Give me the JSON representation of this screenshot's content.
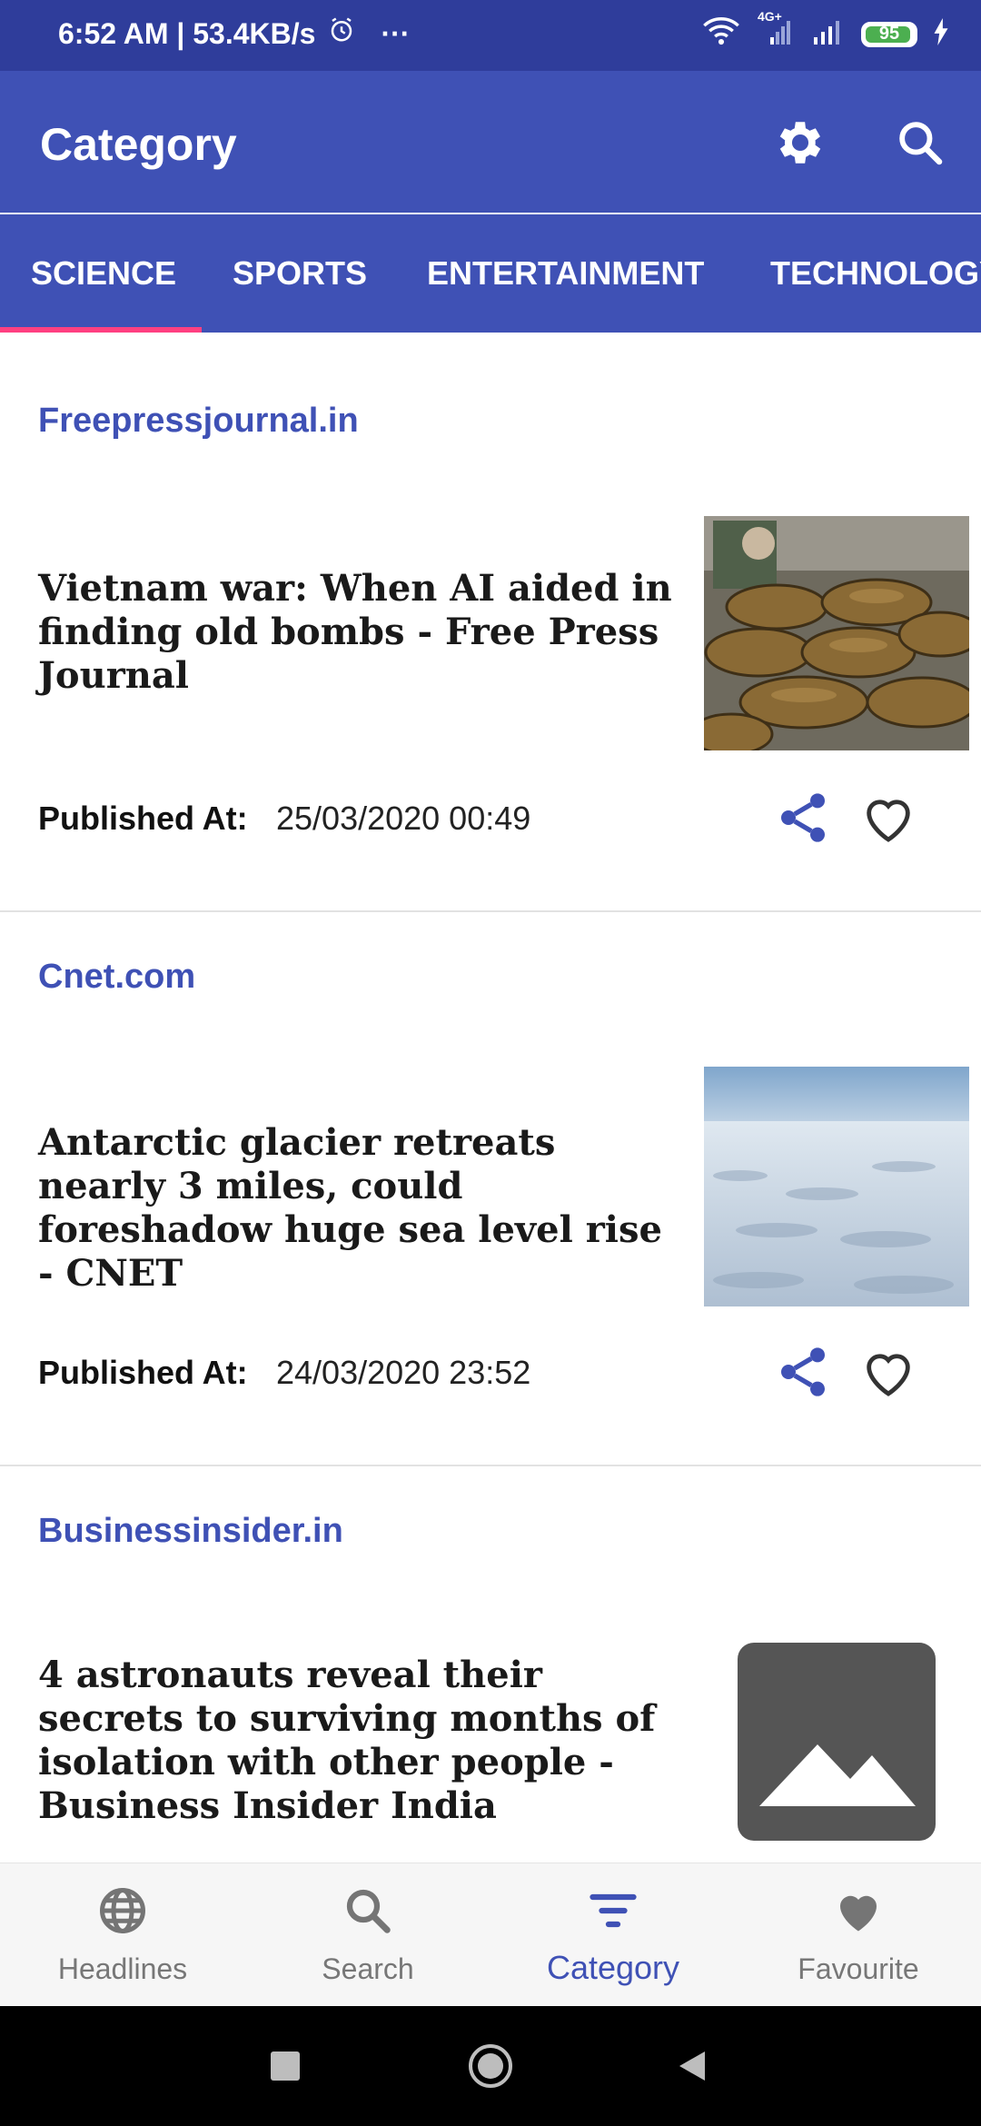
{
  "status_bar": {
    "time_speed": "6:52 AM | 53.4KB/s",
    "more": "···",
    "network_label": "4G+",
    "battery": "95",
    "battery_level": 0.95
  },
  "app_bar": {
    "title": "Category",
    "icons": [
      "gear-icon",
      "search-icon"
    ]
  },
  "tabs": [
    {
      "label": "SCIENCE",
      "selected": true
    },
    {
      "label": "SPORTS",
      "selected": false
    },
    {
      "label": "ENTERTAINMENT",
      "selected": false
    },
    {
      "label": "TECHNOLOGY",
      "selected": false
    }
  ],
  "articles": [
    {
      "source": "Freepressjournal.in",
      "title": "Vietnam war: When AI aided in finding old bombs - Free Press Journal",
      "published_label": "Published At:",
      "published_at": "25/03/2020 00:49"
    },
    {
      "source": "Cnet.com",
      "title": "Antarctic glacier retreats nearly 3 miles, could foreshadow huge sea level rise - CNET",
      "published_label": "Published At:",
      "published_at": "24/03/2020 23:52"
    },
    {
      "source": "Businessinsider.in",
      "title": "4 astronauts reveal their secrets to surviving months of isolation with other people - Business Insider India"
    }
  ],
  "bottom_nav": [
    {
      "label": "Headlines",
      "icon": "globe-icon",
      "active": false
    },
    {
      "label": "Search",
      "icon": "search-icon",
      "active": false
    },
    {
      "label": "Category",
      "icon": "filter-icon",
      "active": true
    },
    {
      "label": "Favourite",
      "icon": "heart-icon",
      "active": false
    }
  ],
  "colors": {
    "primary": "#3f51b5",
    "status_bar": "#2f3d9b",
    "accent": "#ff4081",
    "source_text": "#3f51b5"
  }
}
